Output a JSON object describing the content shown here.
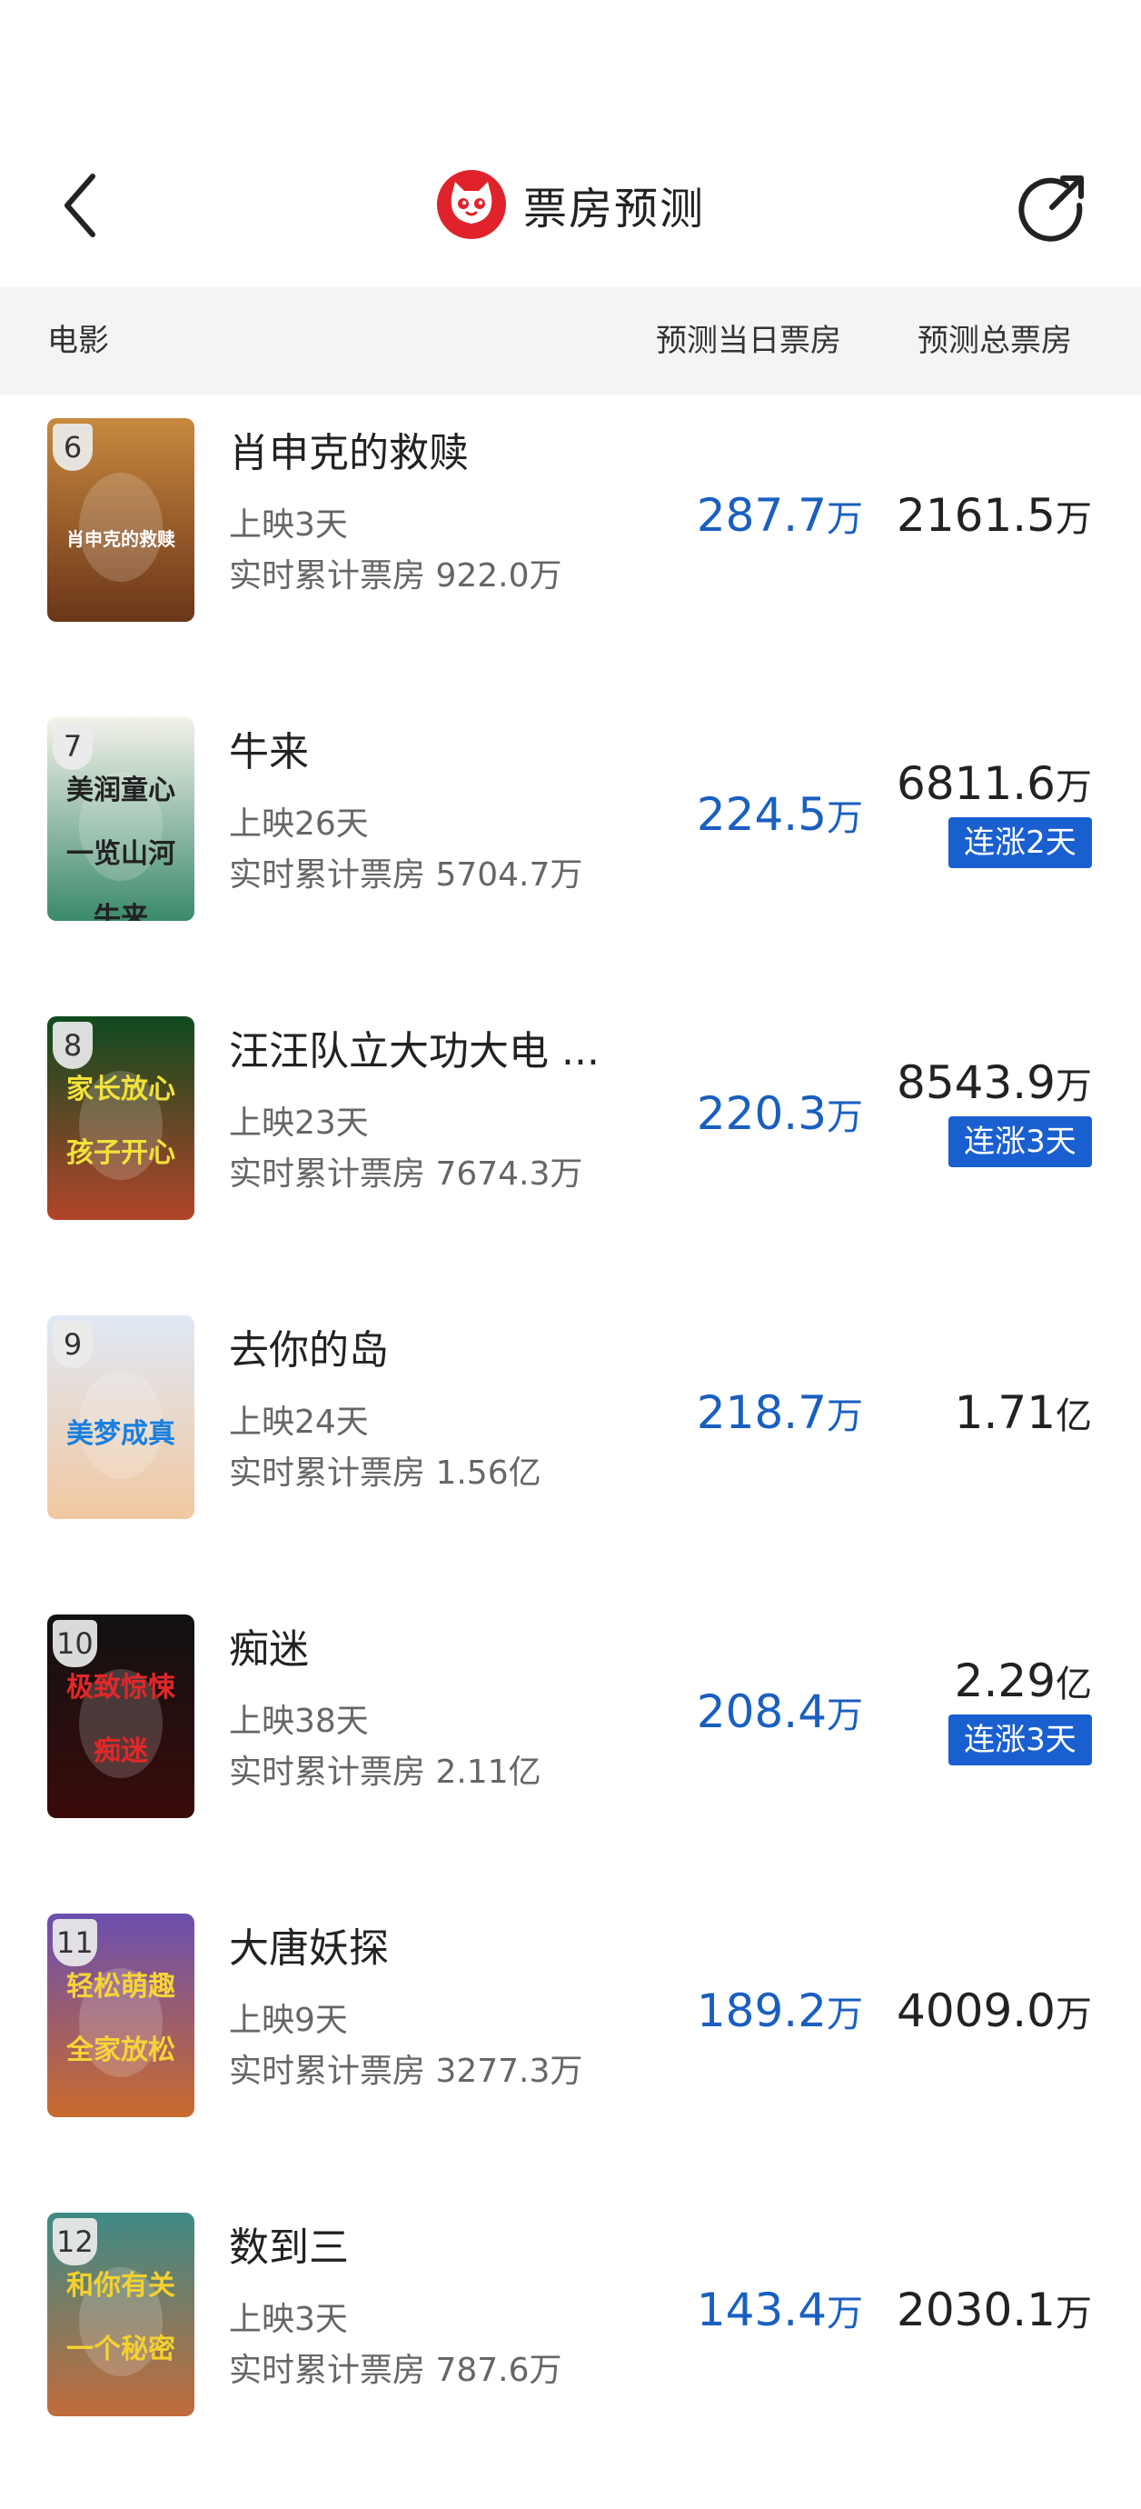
{
  "header": {
    "title": "票房预测",
    "back_icon": "chevron-left-icon",
    "share_icon": "share-icon",
    "logo_icon": "maoyan-cat-logo"
  },
  "table_header": {
    "movie": "电影",
    "day_forecast": "预测当日票房",
    "total_forecast": "预测总票房"
  },
  "colors": {
    "accent_blue": "#1a5fc0",
    "badge_blue": "#1a5fd0",
    "header_bg": "#f4f4f4",
    "logo_red": "#e0222b"
  },
  "movies": [
    {
      "rank": "6",
      "name": "肖申克的救赎",
      "days": "上映3天",
      "cumulative": "实时累计票房 922.0万",
      "day_value": "287.7",
      "day_unit": "万",
      "total_value": "2161.5",
      "total_unit": "万",
      "badge": ""
    },
    {
      "rank": "7",
      "name": "牛来",
      "days": "上映26天",
      "cumulative": "实时累计票房 5704.7万",
      "day_value": "224.5",
      "day_unit": "万",
      "total_value": "6811.6",
      "total_unit": "万",
      "badge": "连涨2天"
    },
    {
      "rank": "8",
      "name": "汪汪队立大功大电 ...",
      "days": "上映23天",
      "cumulative": "实时累计票房 7674.3万",
      "day_value": "220.3",
      "day_unit": "万",
      "total_value": "8543.9",
      "total_unit": "万",
      "badge": "连涨3天"
    },
    {
      "rank": "9",
      "name": "去你的岛",
      "days": "上映24天",
      "cumulative": "实时累计票房 1.56亿",
      "day_value": "218.7",
      "day_unit": "万",
      "total_value": "1.71",
      "total_unit": "亿",
      "badge": ""
    },
    {
      "rank": "10",
      "name": "痴迷",
      "days": "上映38天",
      "cumulative": "实时累计票房 2.11亿",
      "day_value": "208.4",
      "day_unit": "万",
      "total_value": "2.29",
      "total_unit": "亿",
      "badge": "连涨3天"
    },
    {
      "rank": "11",
      "name": "大唐妖探",
      "days": "上映9天",
      "cumulative": "实时累计票房 3277.3万",
      "day_value": "189.2",
      "day_unit": "万",
      "total_value": "4009.0",
      "total_unit": "万",
      "badge": ""
    },
    {
      "rank": "12",
      "name": "数到三",
      "days": "上映3天",
      "cumulative": "实时累计票房 787.6万",
      "day_value": "143.4",
      "day_unit": "万",
      "total_value": "2030.1",
      "total_unit": "万",
      "badge": ""
    }
  ],
  "posters": [
    {
      "lines": [
        "肖申克的救赎"
      ],
      "bg": [
        "#c8893f",
        "#6b3518"
      ],
      "fg": "#ffffff"
    },
    {
      "lines": [
        "美润童心",
        "一览山河",
        "牛来"
      ],
      "bg": [
        "#f4f2ea",
        "#3b8a6b"
      ],
      "fg": "#222222"
    },
    {
      "lines": [
        "家长放心",
        "孩子开心"
      ],
      "bg": [
        "#0f4a1e",
        "#b2452a"
      ],
      "fg": "#f2e23a"
    },
    {
      "lines": [
        "美梦成真"
      ],
      "bg": [
        "#dfe8f6",
        "#f2c8a0"
      ],
      "fg": "#1a7fe0"
    },
    {
      "lines": [
        "极致惊悚",
        "痴迷"
      ],
      "bg": [
        "#111111",
        "#3a0b0b"
      ],
      "fg": "#e0282a"
    },
    {
      "lines": [
        "轻松萌趣",
        "全家放松"
      ],
      "bg": [
        "#6b4fb0",
        "#c96b2c"
      ],
      "fg": "#f7d33a"
    },
    {
      "lines": [
        "和你有关",
        "一个秘密"
      ],
      "bg": [
        "#3e8a86",
        "#c26b3b"
      ],
      "fg": "#f4d12f"
    }
  ]
}
